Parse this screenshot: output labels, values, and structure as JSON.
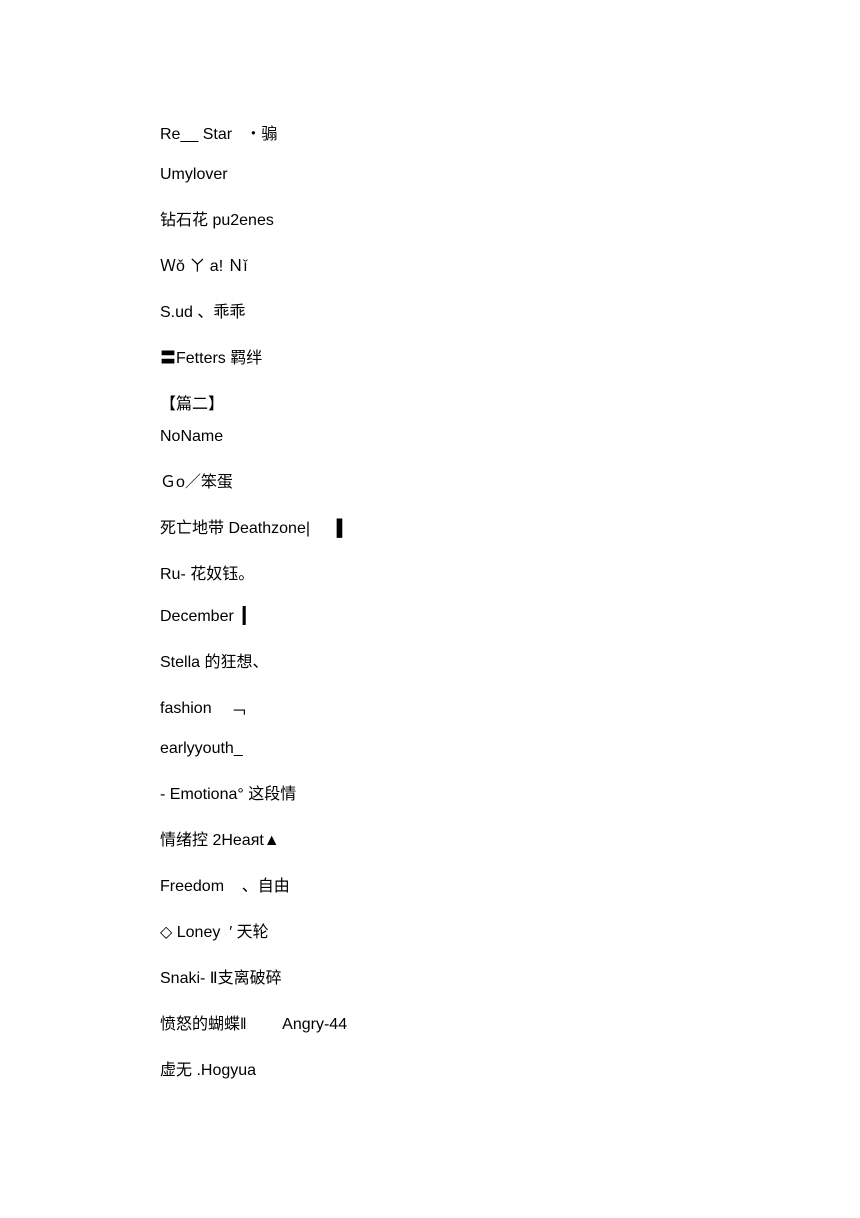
{
  "lines": [
    "Re__ Star   ・骟",
    "Umylover",
    "钻石花 pu2enes",
    "Ｗǒ ㄚ a! Ｎǐ",
    "S.ud 、乖乖",
    "〓Fetters 羁绊",
    "【篇二】",
    "NoName",
    "Ｇo／笨蛋",
    "死亡地带 Deathzone|      ▌",
    "Ru- 花奴钰。",
    "December  ▎",
    "Stella 的狂想、",
    "fashion    ﹁",
    "earlyyouth_",
    "",
    "- Emotiona° 这段情",
    "情绪控 2Нeаᴙt▲",
    "Freedom    、自由",
    "◇ Loney  ′ 天轮",
    "Snaki- Ⅱ支离破碎",
    "愤怒的蝴蝶‖        Angry-44",
    "虚无 .Hogyua"
  ]
}
